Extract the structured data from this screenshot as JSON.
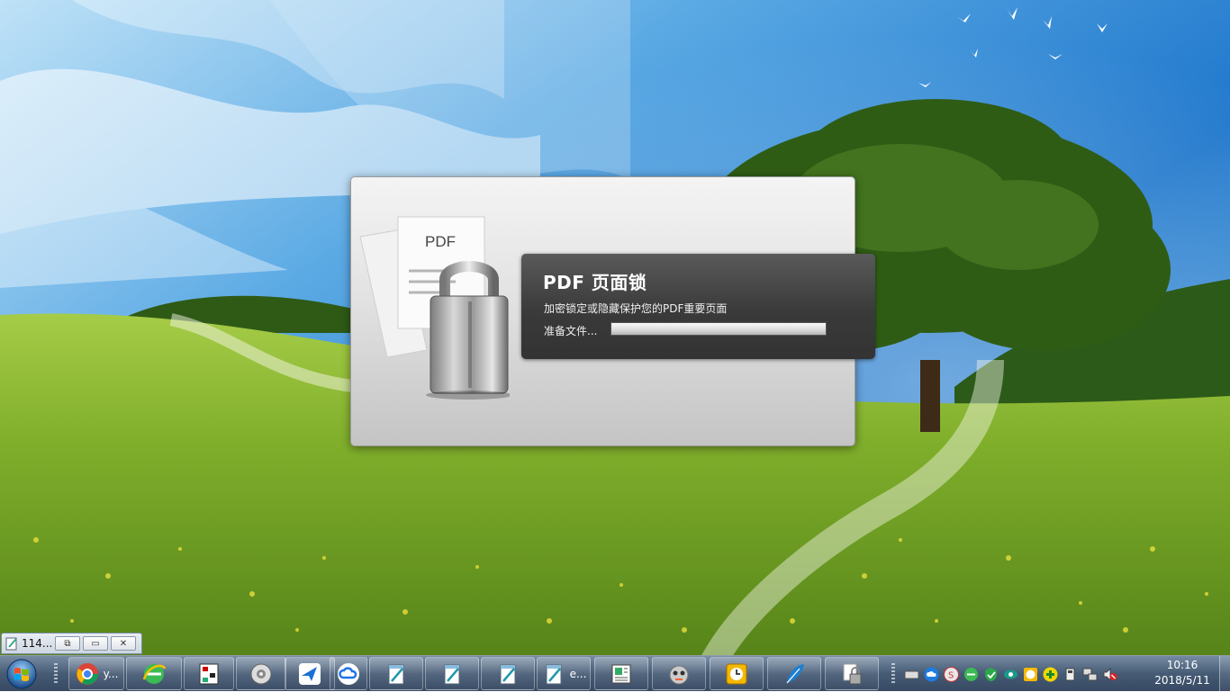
{
  "splash": {
    "doc_label": "PDF",
    "title": "PDF 页面锁",
    "subtitle": "加密锁定或隐藏保护您的PDF重要页面",
    "status": "准备文件...",
    "progress": 1.0
  },
  "thumbbar": {
    "label": "114...",
    "restore_glyph": "⧉",
    "maximize_glyph": "▭",
    "close_glyph": "✕"
  },
  "taskbar": {
    "items": [
      {
        "icon": "chrome-icon",
        "label": "y..."
      },
      {
        "icon": "ie-browser-icon",
        "label": ""
      },
      {
        "icon": "network-app-icon",
        "label": ""
      },
      {
        "icon": "settings-gear-icon",
        "label": ""
      },
      {
        "icon": "bird-app-icon",
        "label": ""
      },
      {
        "icon": "cloud-app-icon",
        "label": ""
      },
      {
        "icon": "notepad-icon",
        "label": ""
      },
      {
        "icon": "notepad-icon",
        "label": ""
      },
      {
        "icon": "notepad-icon",
        "label": ""
      },
      {
        "icon": "notepad-icon",
        "label": "e..."
      },
      {
        "icon": "document-app-icon",
        "label": ""
      },
      {
        "icon": "robot-app-icon",
        "label": ""
      },
      {
        "icon": "clock-app-icon",
        "label": ""
      },
      {
        "icon": "feather-app-icon",
        "label": ""
      },
      {
        "icon": "pdf-lock-icon",
        "label": ""
      }
    ],
    "tray": [
      "keyboard-icon",
      "cloud-sync-icon",
      "shield-s-icon",
      "ie-green-icon",
      "security-shield-icon",
      "eye-icon",
      "timer-icon",
      "plus-icon",
      "usb-device-icon",
      "network-icon",
      "mute-volume-icon"
    ],
    "time": "10:16",
    "date": "2018/5/11"
  }
}
